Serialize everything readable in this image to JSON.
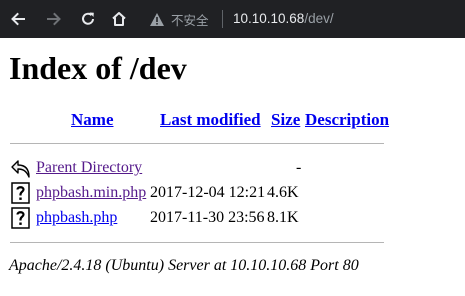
{
  "browser": {
    "security_label": "不安全",
    "url_host": "10.10.10.68",
    "url_path": "/dev/"
  },
  "page": {
    "title": "Index of /dev",
    "columns": {
      "name": "Name",
      "last_modified": "Last modified",
      "size": "Size",
      "description": "Description"
    },
    "rows": [
      {
        "name": "Parent Directory",
        "modified": "",
        "size": "-",
        "icon": "back-arrow-icon"
      },
      {
        "name": "phpbash.min.php",
        "modified": "2017-12-04 12:21",
        "size": "4.6K",
        "icon": "unknown-file-icon"
      },
      {
        "name": "phpbash.php",
        "modified": "2017-11-30 23:56",
        "size": "8.1K",
        "icon": "unknown-file-icon"
      }
    ],
    "address": "Apache/2.4.18 (Ubuntu) Server at 10.10.10.68 Port 80"
  },
  "colors": {
    "link": "#0000ee",
    "visited_link": "#551a8b",
    "chrome_bg": "#202124"
  }
}
